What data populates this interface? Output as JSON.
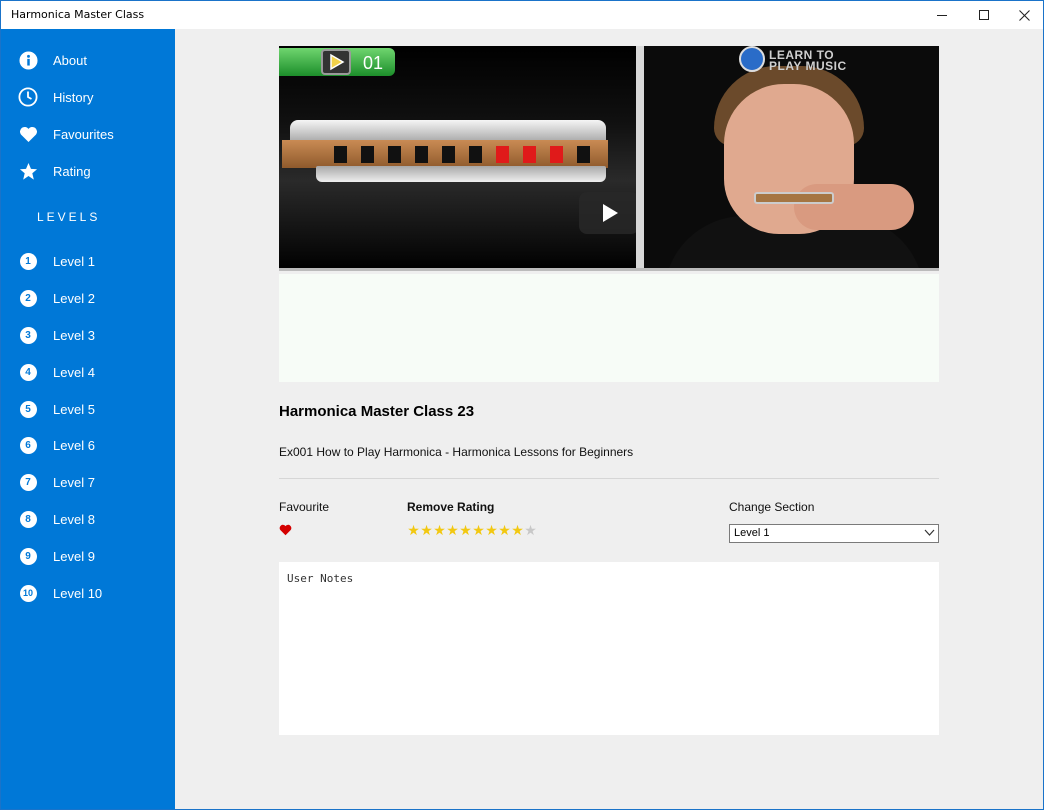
{
  "window": {
    "title": "Harmonica Master Class"
  },
  "sidebar": {
    "menu": [
      {
        "label": "About",
        "icon": "info-icon"
      },
      {
        "label": "History",
        "icon": "clock-icon"
      },
      {
        "label": "Favourites",
        "icon": "heart-icon"
      },
      {
        "label": "Rating",
        "icon": "star-icon"
      }
    ],
    "levels_heading": "LEVELS",
    "levels": [
      {
        "num": "1",
        "label": "Level 1"
      },
      {
        "num": "2",
        "label": "Level 2"
      },
      {
        "num": "3",
        "label": "Level 3"
      },
      {
        "num": "4",
        "label": "Level 4"
      },
      {
        "num": "5",
        "label": "Level 5"
      },
      {
        "num": "6",
        "label": "Level 6"
      },
      {
        "num": "7",
        "label": "Level 7"
      },
      {
        "num": "8",
        "label": "Level 8"
      },
      {
        "num": "9",
        "label": "Level 9"
      },
      {
        "num": "10",
        "label": "Level 10"
      }
    ]
  },
  "video": {
    "counter": "01",
    "logo_text_line1": "LEARN TO",
    "logo_text_line2": "PLAY MUSIC"
  },
  "lesson": {
    "title": "Harmonica Master Class 23",
    "description": "Ex001 How to Play Harmonica - Harmonica Lessons for Beginners"
  },
  "favourite": {
    "label": "Favourite",
    "is_favourite": true
  },
  "rating": {
    "label": "Remove Rating",
    "value": 9,
    "max": 10
  },
  "section": {
    "label": "Change Section",
    "selected": "Level 1"
  },
  "notes": {
    "placeholder": "User Notes",
    "value": ""
  },
  "colors": {
    "accent": "#0078d7",
    "star": "#f2c811",
    "heart": "#d40000"
  }
}
